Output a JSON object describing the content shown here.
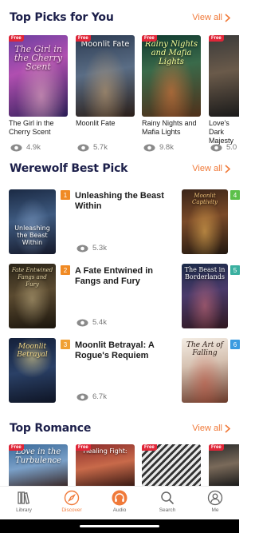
{
  "sections": {
    "top_picks": {
      "title": "Top Picks for You",
      "view_all": "View all"
    },
    "werewolf": {
      "title": "Werewolf Best Pick",
      "view_all": "View all"
    },
    "romance": {
      "title": "Top Romance",
      "view_all": "View all"
    }
  },
  "free_badge": "Free",
  "top_picks": [
    {
      "title": "The Girl in the Cherry Scent",
      "cover_text": "The Girl in the Cherry Scent",
      "views": "4.9k"
    },
    {
      "title": "Moonlit Fate",
      "cover_text": "Moonlit Fate",
      "views": "5.7k"
    },
    {
      "title": "Rainy Nights and Mafia Lights",
      "cover_text": "Rainy Nights and Mafia Lights",
      "views": "9.8k"
    },
    {
      "title": "Love's Dark Majesty",
      "cover_text": "",
      "views": "5.0"
    }
  ],
  "werewolf": [
    {
      "rank": "1",
      "title": "Unleashing the Beast Within",
      "cover_text": "Unleashing the Beast Within",
      "views": "5.3k"
    },
    {
      "rank": "2",
      "title": "A Fate Entwined in Fangs and Fury",
      "cover_text": "Fate Entwined Fangs and Fury",
      "views": "5.4k"
    },
    {
      "rank": "3",
      "title": "Moonlit Betrayal: A Rogue's Requiem",
      "cover_text": "Moonlit Betrayal",
      "views": "6.7k"
    }
  ],
  "werewolf_side": [
    {
      "rank": "4",
      "cover_text": "Moonlit Captivity"
    },
    {
      "rank": "5",
      "cover_text": "The Beast in Borderlands"
    },
    {
      "rank": "6",
      "cover_text": "The Art of Falling"
    }
  ],
  "romance_covers": [
    {
      "cover_text": "Love in the Turbulence"
    },
    {
      "cover_text": "Healing Fight:"
    },
    {
      "cover_text": ""
    },
    {
      "cover_text": ""
    }
  ],
  "nav": [
    {
      "label": "Library",
      "icon": "library-icon"
    },
    {
      "label": "Discover",
      "icon": "compass-icon"
    },
    {
      "label": "Audio",
      "icon": "headphones-icon"
    },
    {
      "label": "Search",
      "icon": "search-icon"
    },
    {
      "label": "Me",
      "icon": "profile-icon"
    }
  ],
  "colors": {
    "accent": "#f07a3a",
    "title": "#1c1f4a",
    "free_badge": "#e02638",
    "rank1": "#f08a24",
    "rank2": "#f08a24",
    "rank3": "#f0a034",
    "rank4": "#5cc04a",
    "rank5": "#3ab0a0",
    "rank6": "#3a9be0"
  }
}
